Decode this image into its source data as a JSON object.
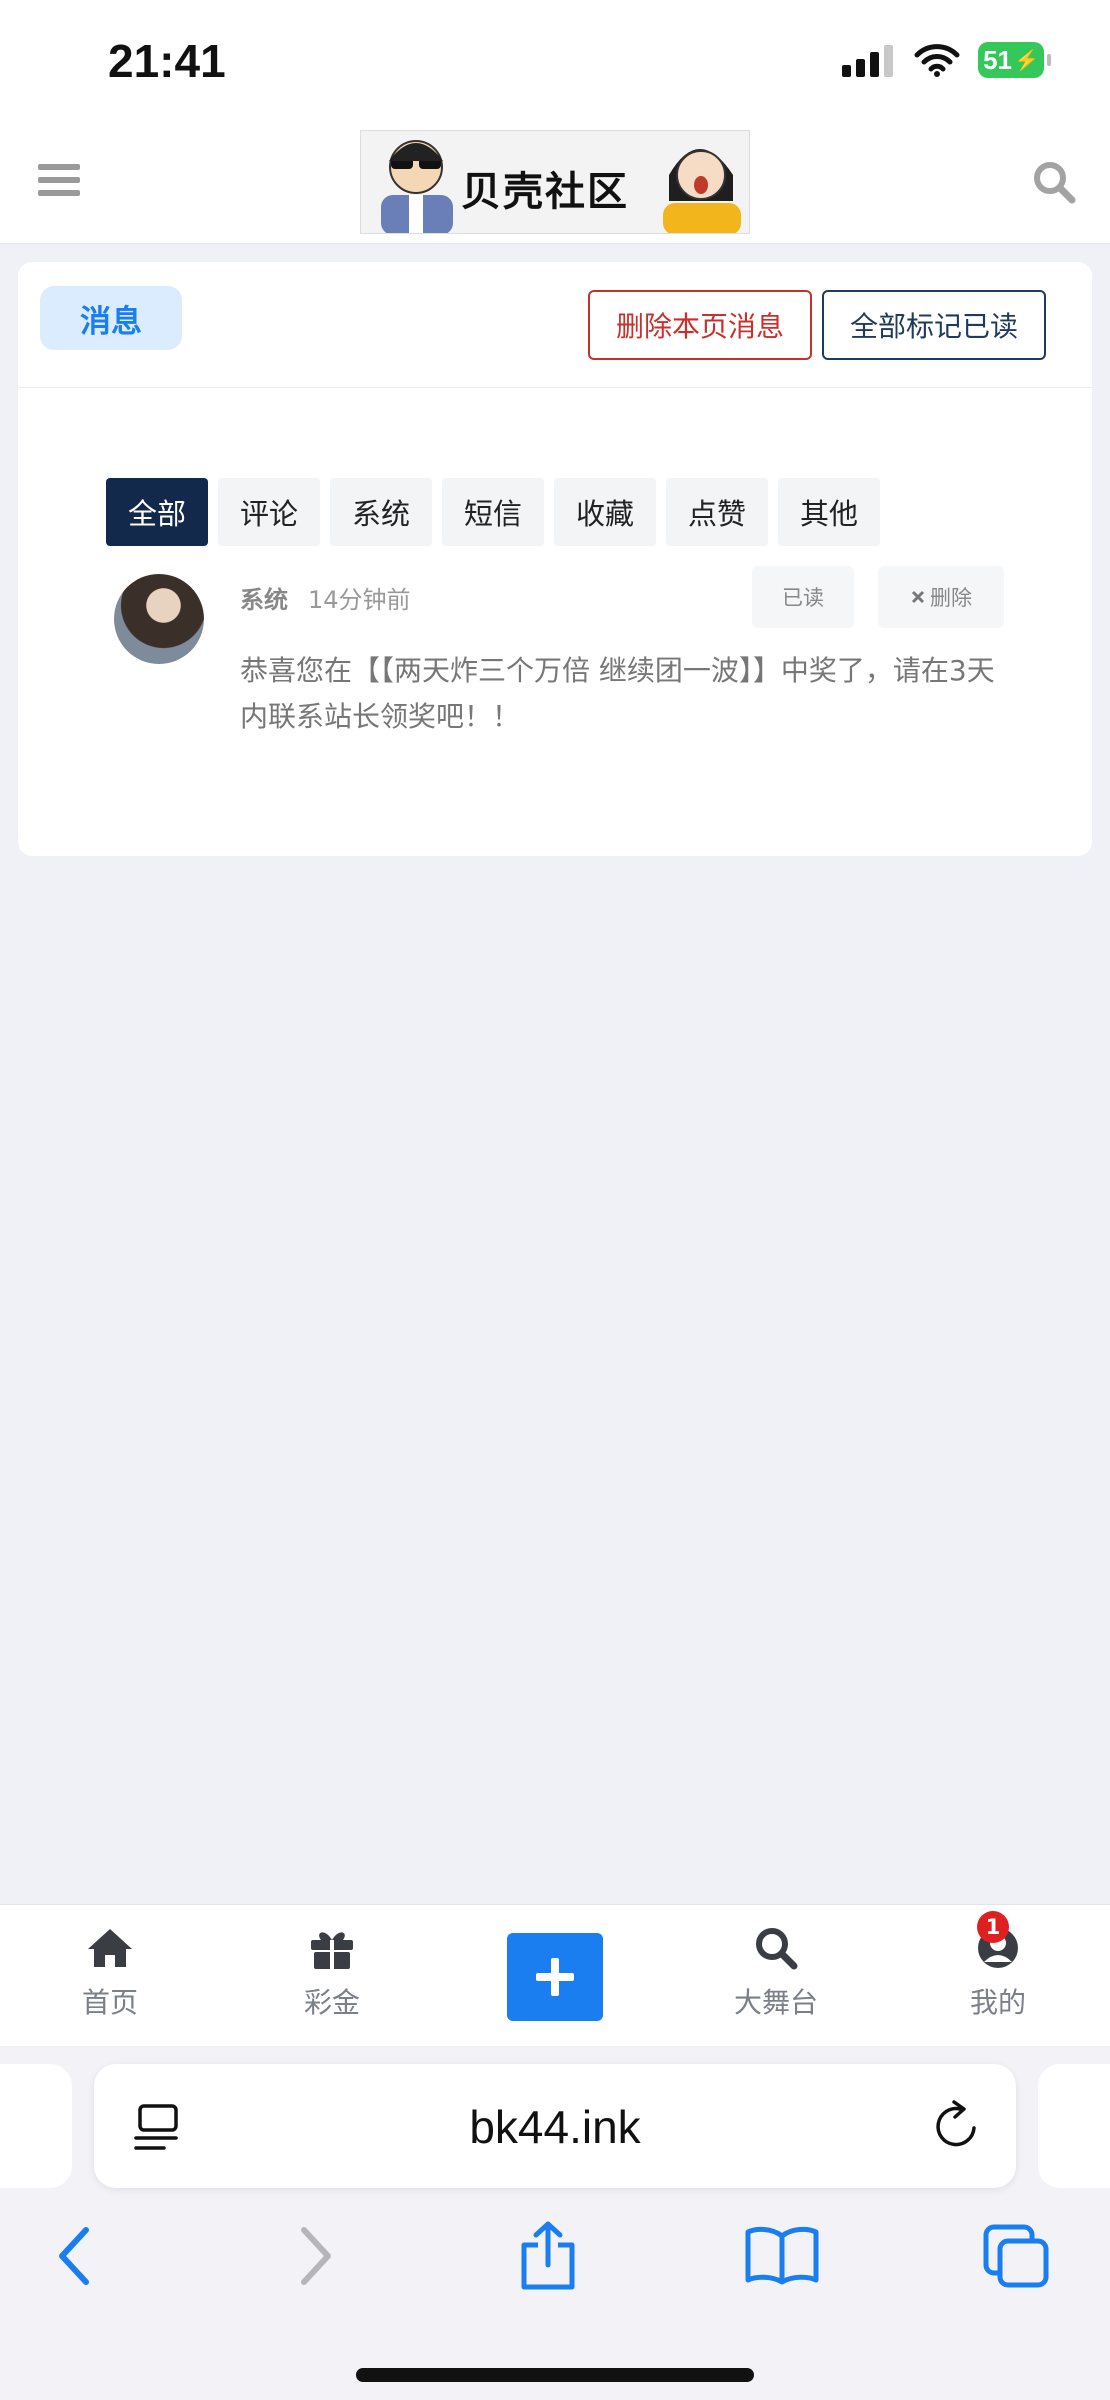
{
  "status_bar": {
    "time": "21:41",
    "battery": "51"
  },
  "header": {
    "logo_text": "贝壳社区"
  },
  "card": {
    "title_pill": "消息",
    "delete_page_label": "删除本页消息",
    "mark_all_label": "全部标记已读",
    "filter_tabs": [
      {
        "label": "全部",
        "active": true
      },
      {
        "label": "评论",
        "active": false
      },
      {
        "label": "系统",
        "active": false
      },
      {
        "label": "短信",
        "active": false
      },
      {
        "label": "收藏",
        "active": false
      },
      {
        "label": "点赞",
        "active": false
      },
      {
        "label": "其他",
        "active": false
      }
    ],
    "message": {
      "sender": "系统",
      "time": "14分钟前",
      "read_label": "已读",
      "delete_label": "删除",
      "body": "恭喜您在【【两天炸三个万倍 继续团一波】】中奖了，请在3天内联系站长领奖吧！！"
    }
  },
  "bottom_nav": {
    "items": [
      {
        "label": "首页",
        "icon": "home-icon"
      },
      {
        "label": "彩金",
        "icon": "gift-icon"
      },
      {
        "label": "大舞台",
        "icon": "search-icon"
      },
      {
        "label": "我的",
        "icon": "user-icon"
      }
    ],
    "profile_badge": "1",
    "accent_color": "#1a7ef0"
  },
  "browser": {
    "url": "bk44.ink"
  }
}
